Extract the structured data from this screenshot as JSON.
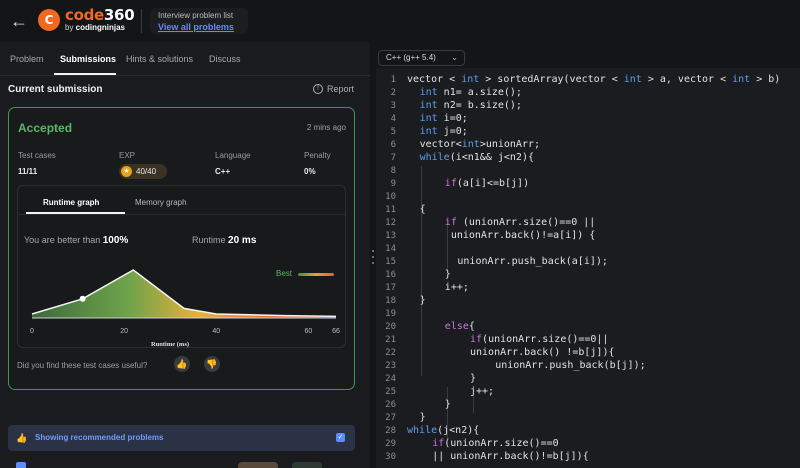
{
  "header": {
    "logo_brand": "code",
    "logo_number": "360",
    "logo_sub_prefix": "by ",
    "logo_sub_brand": "codingninjas",
    "crumb_title": "Interview problem list",
    "crumb_link": "View all problems"
  },
  "tabs": [
    {
      "label": "Problem",
      "active": false
    },
    {
      "label": "Submissions",
      "active": true
    },
    {
      "label": "Hints & solutions",
      "active": false
    },
    {
      "label": "Discuss",
      "active": false
    }
  ],
  "submission": {
    "heading": "Current submission",
    "report_label": "Report",
    "status": "Accepted",
    "time_ago": "2 mins ago",
    "stats": {
      "test_cases_label": "Test cases",
      "test_cases_value": "11/11",
      "exp_label": "EXP",
      "exp_value": "40/40",
      "language_label": "Language",
      "language_value": "C++",
      "penalty_label": "Penalty",
      "penalty_value": "0%"
    },
    "graph_tabs": {
      "runtime": "Runtime graph",
      "memory": "Memory graph"
    },
    "better_than_label": "You are better than",
    "better_than_value": "100%",
    "runtime_label": "Runtime",
    "runtime_value": "20 ms",
    "best_label": "Best",
    "useful_question": "Did you find these test cases useful?",
    "recommended_label": "Showing recommended problems"
  },
  "chart_data": {
    "type": "area",
    "title": "",
    "xlabel": "Runtime (ms)",
    "ylabel": "",
    "x_ticks": [
      "0",
      "20",
      "40",
      "60",
      "66"
    ],
    "xlim": [
      0,
      66
    ],
    "x": [
      0,
      11,
      22,
      33,
      40,
      55,
      66
    ],
    "y": [
      0.05,
      0.24,
      0.6,
      0.12,
      0.05,
      0.03,
      0.02
    ],
    "marker_x": 11,
    "legend": "top-right"
  },
  "editor": {
    "language": "C++ (g++ 5.4)",
    "lines": [
      {
        "n": "1",
        "indent": 0,
        "parts": [
          [
            "",
            "vector < "
          ],
          [
            "kw",
            "int"
          ],
          [
            "",
            " > sortedArray(vector < "
          ],
          [
            "kw",
            "int"
          ],
          [
            "",
            " > a, vector < "
          ],
          [
            "kw",
            "int"
          ],
          [
            "",
            " > b)"
          ]
        ]
      },
      {
        "n": "2",
        "indent": 1,
        "parts": [
          [
            "kw",
            "int"
          ],
          [
            "",
            " n1= a.size();"
          ]
        ]
      },
      {
        "n": "3",
        "indent": 1,
        "parts": [
          [
            "kw",
            "int"
          ],
          [
            "",
            " n2= b.size();"
          ]
        ]
      },
      {
        "n": "4",
        "indent": 1,
        "parts": [
          [
            "kw",
            "int"
          ],
          [
            "",
            " i=0;"
          ]
        ]
      },
      {
        "n": "5",
        "indent": 1,
        "parts": [
          [
            "kw",
            "int"
          ],
          [
            "",
            " j=0;"
          ]
        ]
      },
      {
        "n": "6",
        "indent": 1,
        "parts": [
          [
            "",
            "vector<"
          ],
          [
            "kw",
            "int"
          ],
          [
            "",
            ">unionArr;"
          ]
        ]
      },
      {
        "n": "7",
        "indent": 1,
        "parts": [
          [
            "kw",
            "while"
          ],
          [
            "",
            "(i<n1&& j<n2){"
          ]
        ]
      },
      {
        "n": "8",
        "indent": 0,
        "parts": [
          [
            "",
            ""
          ]
        ]
      },
      {
        "n": "9",
        "indent": 3,
        "parts": [
          [
            "kw2",
            "if"
          ],
          [
            "",
            "(a[i]<=b[j])"
          ]
        ]
      },
      {
        "n": "10",
        "indent": 0,
        "parts": [
          [
            "",
            ""
          ]
        ]
      },
      {
        "n": "11",
        "indent": 1,
        "parts": [
          [
            "",
            "{"
          ]
        ]
      },
      {
        "n": "12",
        "indent": 3,
        "parts": [
          [
            "kw2",
            "if"
          ],
          [
            "",
            " (unionArr.size()==0 ||"
          ]
        ]
      },
      {
        "n": "13",
        "indent": 3,
        "parts": [
          [
            "",
            " unionArr.back()!=a[i]) {"
          ]
        ]
      },
      {
        "n": "14",
        "indent": 0,
        "parts": [
          [
            "",
            ""
          ]
        ]
      },
      {
        "n": "15",
        "indent": 4,
        "parts": [
          [
            "",
            "unionArr.push_back(a[i]);"
          ]
        ]
      },
      {
        "n": "16",
        "indent": 3,
        "parts": [
          [
            "",
            "}"
          ]
        ]
      },
      {
        "n": "17",
        "indent": 3,
        "parts": [
          [
            "",
            "i++;"
          ]
        ]
      },
      {
        "n": "18",
        "indent": 1,
        "parts": [
          [
            "",
            "}"
          ]
        ]
      },
      {
        "n": "19",
        "indent": 0,
        "parts": [
          [
            "",
            ""
          ]
        ]
      },
      {
        "n": "20",
        "indent": 3,
        "parts": [
          [
            "kw2",
            "else"
          ],
          [
            "",
            "{"
          ]
        ]
      },
      {
        "n": "21",
        "indent": 5,
        "parts": [
          [
            "kw2",
            "if"
          ],
          [
            "",
            "(unionArr.size()==0||"
          ]
        ]
      },
      {
        "n": "22",
        "indent": 5,
        "parts": [
          [
            "",
            "unionArr.back() !=b[j]){"
          ]
        ]
      },
      {
        "n": "23",
        "indent": 7,
        "parts": [
          [
            "",
            "unionArr.push_back(b[j]);"
          ]
        ]
      },
      {
        "n": "24",
        "indent": 5,
        "parts": [
          [
            "",
            "}"
          ]
        ]
      },
      {
        "n": "25",
        "indent": 5,
        "parts": [
          [
            "",
            "j++;"
          ]
        ]
      },
      {
        "n": "26",
        "indent": 3,
        "parts": [
          [
            "",
            "}"
          ]
        ]
      },
      {
        "n": "27",
        "indent": 1,
        "parts": [
          [
            "",
            "}"
          ]
        ]
      },
      {
        "n": "28",
        "indent": 0,
        "parts": [
          [
            "kw",
            "while"
          ],
          [
            "",
            "(j<n2){"
          ]
        ]
      },
      {
        "n": "29",
        "indent": 2,
        "parts": [
          [
            "kw2",
            "if"
          ],
          [
            "",
            "(unionArr.size()==0"
          ]
        ]
      },
      {
        "n": "30",
        "indent": 2,
        "parts": [
          [
            "",
            "|| unionArr.back()!=b[j]){"
          ]
        ]
      }
    ]
  }
}
